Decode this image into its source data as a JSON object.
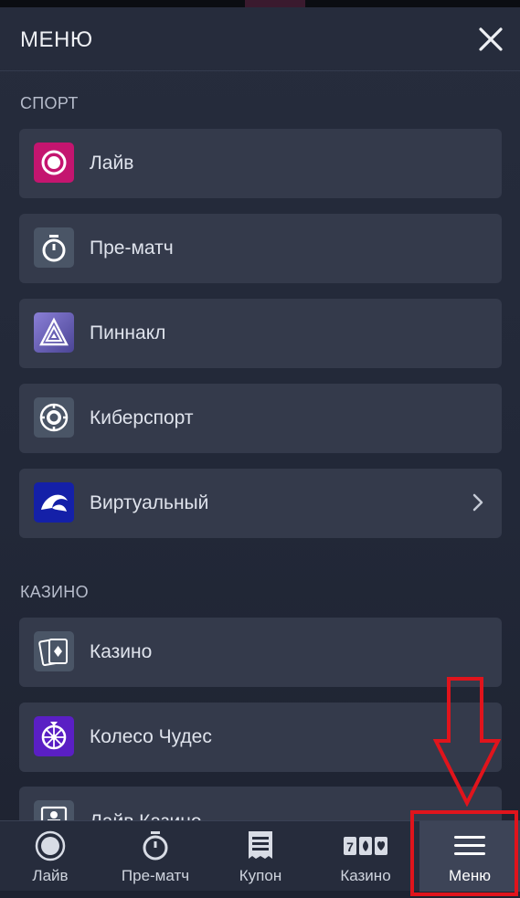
{
  "header": {
    "title": "МЕНЮ"
  },
  "sections": {
    "sport": {
      "label": "СПОРТ",
      "items": [
        {
          "label": "Лайв",
          "icon": "live-record-icon"
        },
        {
          "label": "Пре-матч",
          "icon": "stopwatch-icon"
        },
        {
          "label": "Пиннакл",
          "icon": "pinnacle-triangle-icon"
        },
        {
          "label": "Киберспорт",
          "icon": "esports-chip-icon"
        },
        {
          "label": "Виртуальный",
          "icon": "virtual-logo-icon",
          "has_submenu": true
        }
      ]
    },
    "casino": {
      "label": "КАЗИНО",
      "items": [
        {
          "label": "Казино",
          "icon": "playing-cards-icon"
        },
        {
          "label": "Колесо Чудес",
          "icon": "wheel-icon"
        },
        {
          "label": "Лайв Казино",
          "icon": "live-dealer-icon"
        }
      ]
    }
  },
  "bottom_nav": {
    "items": [
      {
        "label": "Лайв",
        "icon": "live-circle-icon"
      },
      {
        "label": "Пре-матч",
        "icon": "stopwatch-icon"
      },
      {
        "label": "Купон",
        "icon": "coupon-receipt-icon"
      },
      {
        "label": "Казино",
        "icon": "slots-777-icon"
      },
      {
        "label": "Меню",
        "icon": "hamburger-menu-icon",
        "active": true
      }
    ]
  },
  "colors": {
    "background": "#222838",
    "card": "#343a4b",
    "annotation": "#e0141c",
    "live_icon": "#c4156f",
    "virtual_icon": "#1420a8",
    "wheel_icon": "#5a1fc4"
  }
}
